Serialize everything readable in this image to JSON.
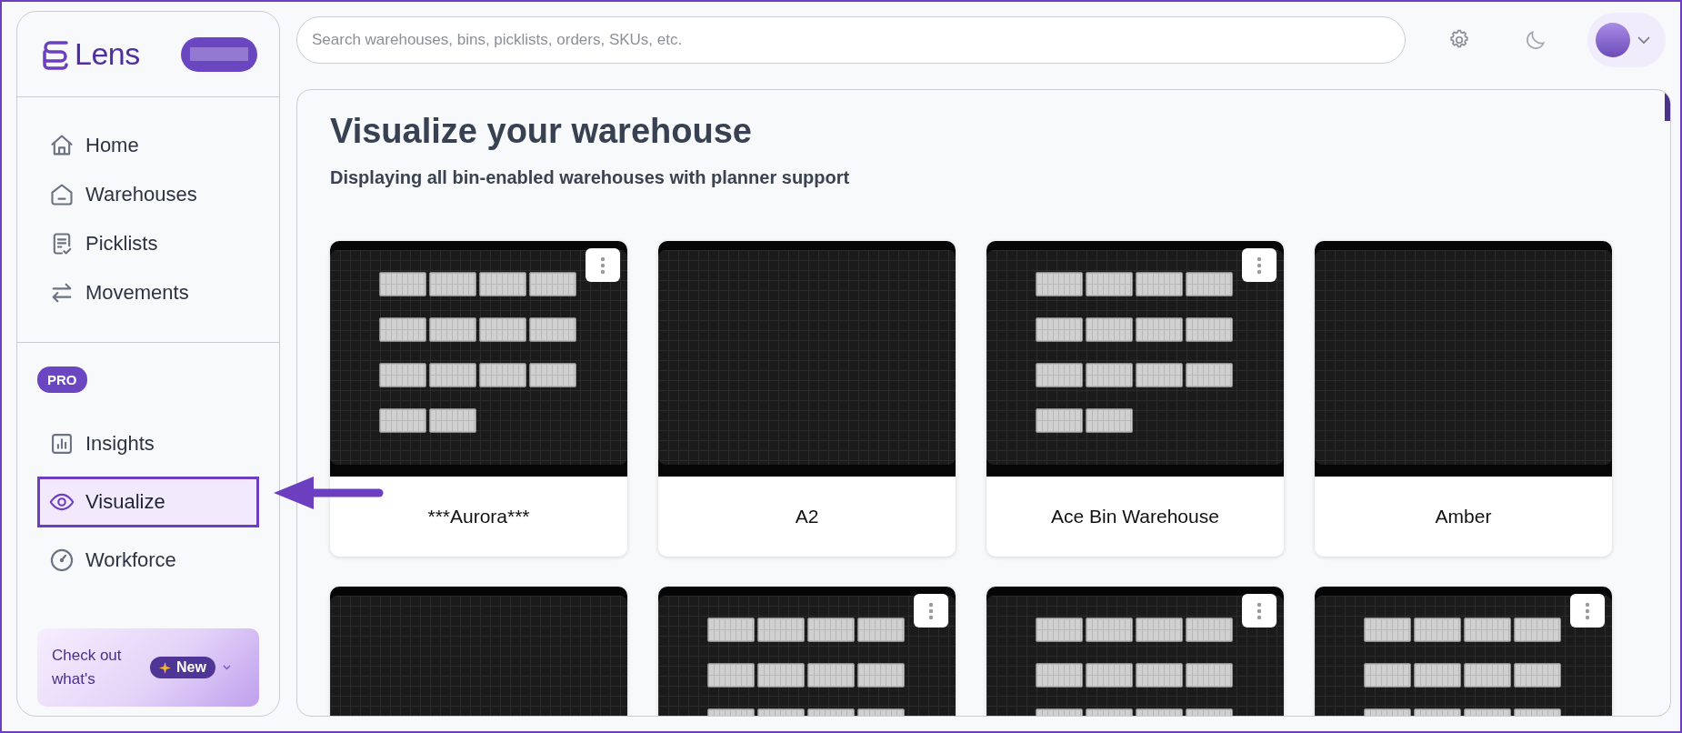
{
  "sidebar": {
    "logo": "Lens",
    "nav": [
      {
        "label": "Home",
        "selected": false
      },
      {
        "label": "Warehouses",
        "selected": false
      },
      {
        "label": "Picklists",
        "selected": false
      },
      {
        "label": "Movements",
        "selected": false
      }
    ],
    "pro_badge": "PRO",
    "pro_nav": [
      {
        "label": "Insights",
        "selected": false
      },
      {
        "label": "Visualize",
        "selected": true
      },
      {
        "label": "Workforce",
        "selected": false
      }
    ],
    "promo": {
      "text": "Check out what's",
      "badge": "New"
    }
  },
  "header": {
    "search": {
      "placeholder": "Search warehouses, bins, picklists, orders, SKUs, etc."
    }
  },
  "main": {
    "title": "Visualize your warehouse",
    "subtitle": "Displaying all bin-enabled warehouses with planner support",
    "cards": [
      {
        "name": "***Aurora***",
        "kind": "large",
        "menu": true
      },
      {
        "name": "A2",
        "kind": "blank",
        "menu": false
      },
      {
        "name": "Ace Bin Warehouse",
        "kind": "large",
        "menu": true
      },
      {
        "name": "Amber",
        "kind": "blank",
        "menu": false
      },
      {
        "kind": "blank",
        "menu": false
      },
      {
        "kind": "small",
        "menu": true
      },
      {
        "kind": "small",
        "menu": true
      },
      {
        "kind": "small",
        "menu": true
      }
    ]
  }
}
